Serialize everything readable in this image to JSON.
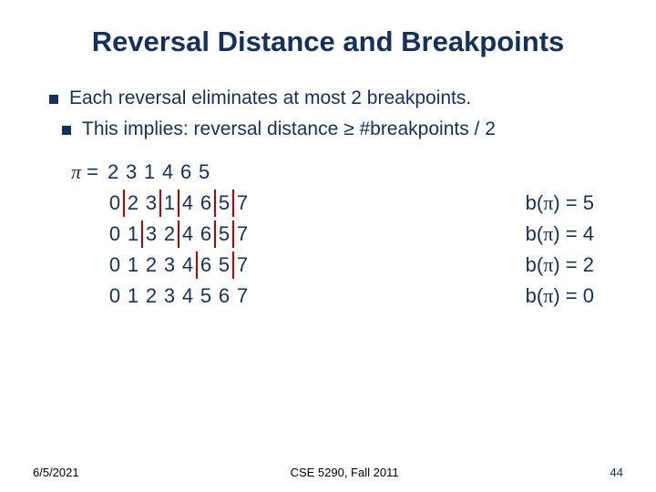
{
  "title": "Reversal Distance and Breakpoints",
  "bullet1": "Each reversal eliminates at most 2 breakpoints.",
  "bullet2": "This implies: reversal distance  ≥  #breakpoints / 2",
  "pi": "π",
  "eq": " = ",
  "perm": {
    "header": [
      "2",
      "3",
      "1",
      "4",
      "6",
      "5"
    ],
    "rows": [
      {
        "digits": [
          "0",
          "2",
          "3",
          "1",
          "4",
          "6",
          "5",
          "7"
        ],
        "bp_after": [
          0,
          2,
          3,
          5,
          6
        ]
      },
      {
        "digits": [
          "0",
          "1",
          "3",
          "2",
          "4",
          "6",
          "5",
          "7"
        ],
        "bp_after": [
          1,
          3,
          5,
          6
        ]
      },
      {
        "digits": [
          "0",
          "1",
          "2",
          "3",
          "4",
          "6",
          "5",
          "7"
        ],
        "bp_after": [
          4,
          6
        ]
      },
      {
        "digits": [
          "0",
          "1",
          "2",
          "3",
          "4",
          "5",
          "6",
          "7"
        ],
        "bp_after": []
      }
    ]
  },
  "score": {
    "label_prefix": "b(",
    "label_suffix": ") = ",
    "values": [
      "5",
      "4",
      "2",
      "0"
    ]
  },
  "footer": {
    "date": "6/5/2021",
    "course": "CSE 5290, Fall 2011",
    "page": "44"
  }
}
